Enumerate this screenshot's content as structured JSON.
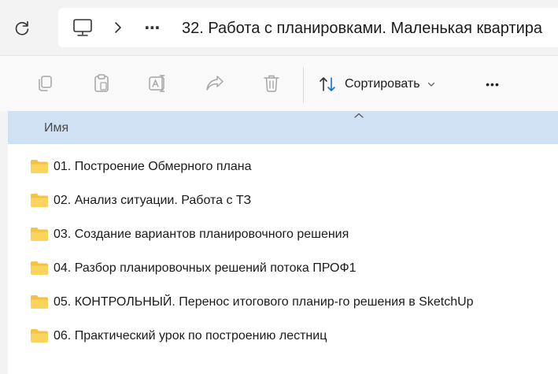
{
  "address_bar": {
    "ellipsis": "⋯",
    "current_folder": "32. Работа с планировками. Маленькая квартира"
  },
  "command_bar": {
    "sort_label": "Сортировать",
    "more_label": "•••"
  },
  "column_header": {
    "name_label": "Имя"
  },
  "files": [
    {
      "name": "01. Построение Обмерного плана",
      "icon": "folder-icon"
    },
    {
      "name": "02. Анализ ситуации. Работа с ТЗ",
      "icon": "folder-icon"
    },
    {
      "name": "03. Создание вариантов планировочного решения",
      "icon": "folder-icon"
    },
    {
      "name": "04. Разбор планировочных решений потока ПРОФ1",
      "icon": "folder-icon"
    },
    {
      "name": "05. КОНТРОЛЬНЫЙ. Перенос итогового планир-го решения в SketchUp",
      "icon": "folder-icon"
    },
    {
      "name": "06. Практический урок по построению лестниц",
      "icon": "folder-icon"
    }
  ],
  "colors": {
    "header_bg": "#cfe1f3",
    "folder": "#f5c342",
    "accent": "#1a6fc9"
  }
}
